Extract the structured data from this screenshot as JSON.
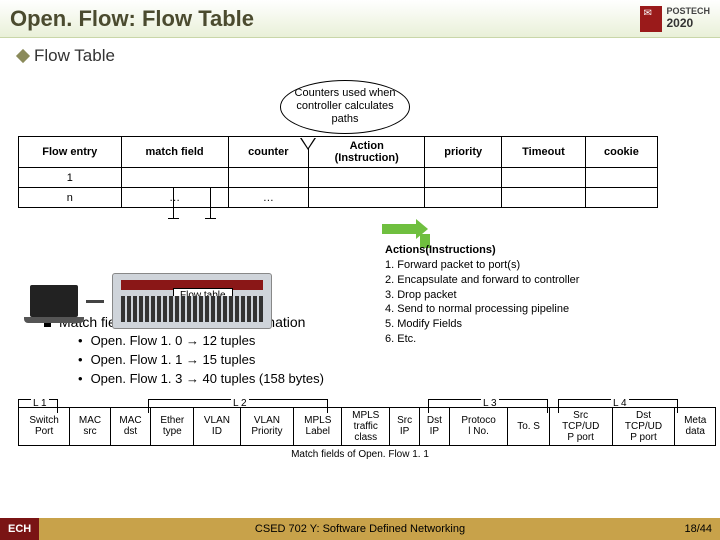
{
  "header": {
    "title": "Open. Flow: Flow Table",
    "brand": "POSTECH",
    "year": "2020"
  },
  "section": {
    "heading": "Flow Table"
  },
  "callout": "Counters used when controller calculates paths",
  "flow_table": {
    "headers": [
      "Flow entry",
      "match field",
      "counter",
      "Action\n(Instruction)",
      "priority",
      "Timeout",
      "cookie"
    ],
    "rows": [
      [
        "1",
        "",
        "",
        "",
        "",
        "",
        ""
      ],
      [
        "n",
        "…",
        "…",
        "",
        "",
        "",
        ""
      ]
    ]
  },
  "devices": {
    "flow_table_label": "Flow table"
  },
  "actions": {
    "heading": "Actions(Instructions)",
    "items": [
      "1. Forward packet to port(s)",
      "2. Encapsulate and forward to controller",
      "3. Drop packet",
      "4. Send to normal processing pipeline",
      "5. Modify Fields",
      "6. Etc."
    ]
  },
  "match_info": {
    "lead": "Match field= L 1~L 4 header information",
    "bullets": [
      "Open. Flow 1. 0 → 12 tuples",
      "Open. Flow 1. 1 → 15 tuples",
      "Open. Flow 1. 3 → 40 tuples (158 bytes)"
    ]
  },
  "layers": {
    "l1": "L 1",
    "l2": "L 2",
    "l3": "L 3",
    "l4": "L 4"
  },
  "fields": [
    "Switch\nPort",
    "MAC\nsrc",
    "MAC\ndst",
    "Ether\ntype",
    "VLAN\nID",
    "VLAN\nPriority",
    "MPLS\nLabel",
    "MPLS\ntraffic\nclass",
    "Src\nIP",
    "Dst\nIP",
    "Protoco\nl No.",
    "To. S",
    "Src\nTCP/UD\nP port",
    "Dst\nTCP/UD\nP port",
    "Meta\ndata"
  ],
  "fields_caption": "Match fields of Open. Flow 1. 1",
  "footer": {
    "left": "ECH",
    "center": "CSED 702 Y: Software Defined Networking",
    "right": "18/44"
  }
}
